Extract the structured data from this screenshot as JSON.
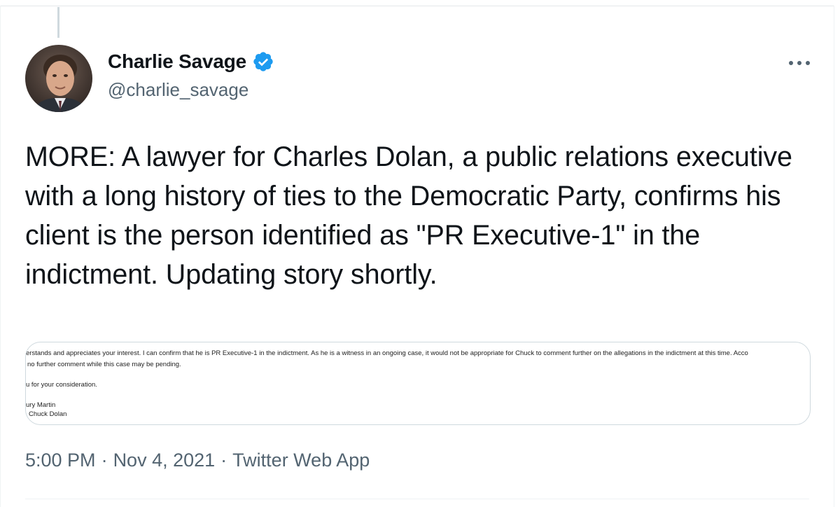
{
  "author": {
    "name": "Charlie Savage",
    "handle": "@charlie_savage",
    "verified": true
  },
  "tweet": {
    "text": "MORE: A lawyer for Charles Dolan, a public relations executive with a long history of ties to the Democratic Party, confirms his client is the person identified as \"PR Executive-1\" in the indictment. Updating story shortly."
  },
  "media": {
    "lines": [
      "erstands and  appreciates your interest.  I can confirm that he is PR Executive-1 in the indictment.  As he is a witness in an ongoing case, it would not be appropriate for Chuck to comment further on the allegations in the indictment at this time.  Acco",
      "no further comment while this case may be pending.",
      "u for your consideration.",
      "ury Martin",
      "Chuck Dolan"
    ]
  },
  "meta": {
    "time": "5:00 PM",
    "separator": "·",
    "date": "Nov 4, 2021",
    "source": "Twitter Web App"
  },
  "colors": {
    "verified": "#1d9bf0",
    "text": "#0f1419",
    "secondary": "#536471",
    "border": "#cfd9de"
  },
  "icons": {
    "verified": "verified-badge-icon",
    "more": "more-options-icon"
  }
}
